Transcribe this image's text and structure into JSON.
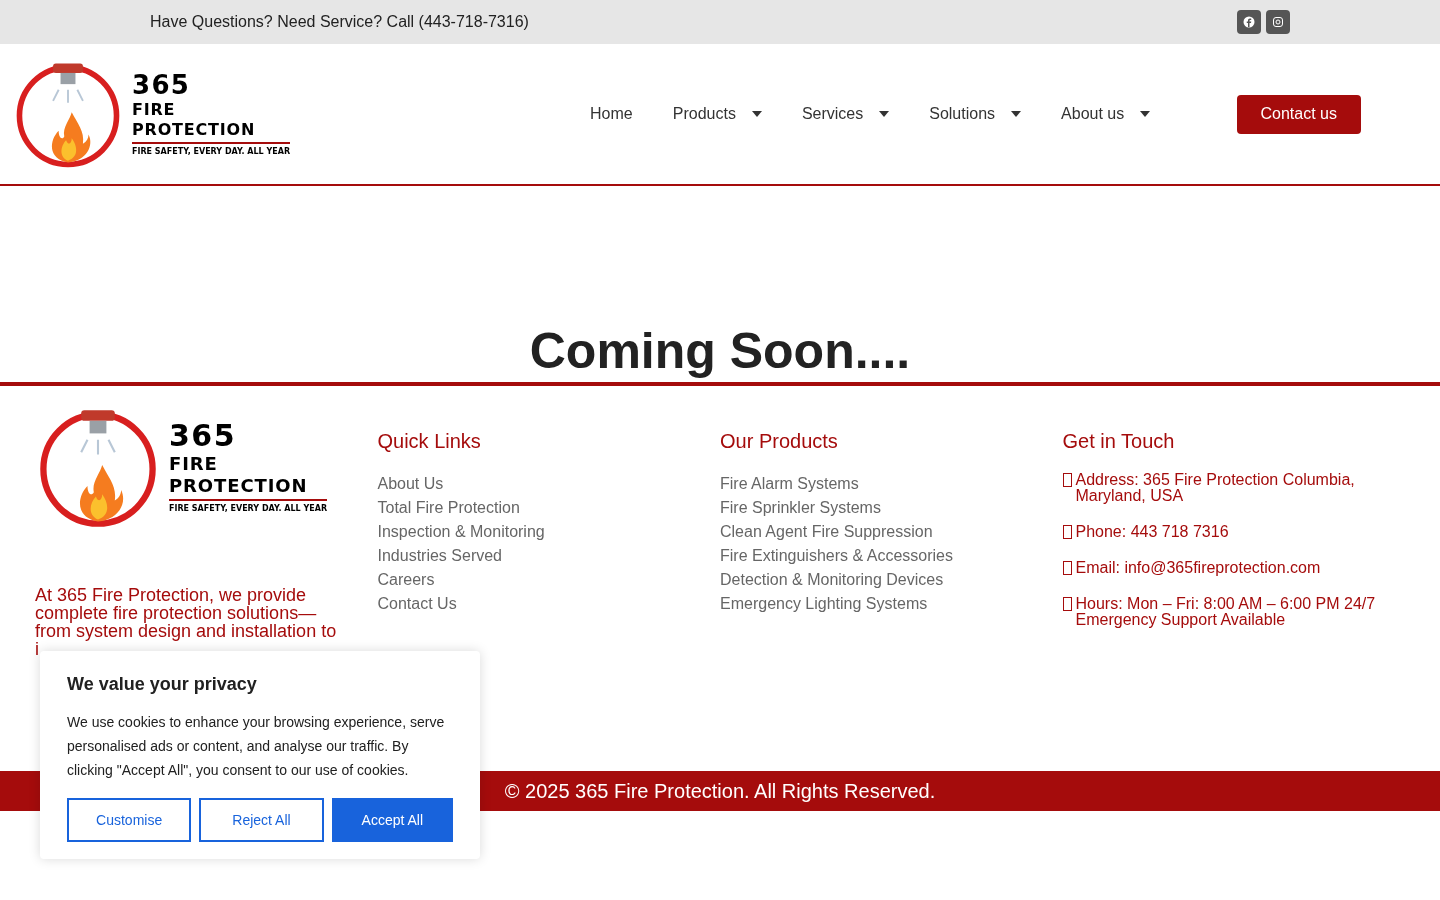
{
  "top_bar": {
    "text": "Have Questions? Need Service? Call (443-718-7316)",
    "social": [
      {
        "kind": "facebook"
      },
      {
        "kind": "instagram"
      }
    ]
  },
  "header_logo": {
    "number": "365",
    "line1": "FIRE",
    "line2": "PROTECTION",
    "tagline": "FIRE SAFETY, EVERY DAY. ALL YEAR"
  },
  "footer_logo": {
    "number": "365",
    "line1": "FIRE",
    "line2": "PROTECTION",
    "tagline": "FIRE SAFETY, EVERY DAY. ALL YEAR"
  },
  "nav": [
    {
      "label": "Home",
      "dropdown": false
    },
    {
      "label": "Products",
      "dropdown": true
    },
    {
      "label": "Services",
      "dropdown": true
    },
    {
      "label": "Solutions",
      "dropdown": true
    },
    {
      "label": "About us",
      "dropdown": true
    }
  ],
  "contact_button": "Contact us",
  "heading": "Coming Soon....",
  "footer": {
    "about_lines": [
      "At 365 Fire Protection, we provide",
      "complete fire protection solutions—",
      "from system design and installation to",
      "i"
    ],
    "quick_links": {
      "title": "Quick Links",
      "items": [
        "About Us",
        "Total Fire Protection",
        "Inspection & Monitoring",
        "Industries Served",
        "Careers",
        "Contact Us"
      ]
    },
    "products": {
      "title": "Our Products",
      "items": [
        "Fire Alarm Systems",
        "Fire Sprinkler Systems",
        "Clean Agent Fire Suppression",
        "Fire Extinguishers & Accessories",
        "Detection & Monitoring Devices",
        "Emergency Lighting Systems"
      ]
    },
    "contact": {
      "title": "Get in Touch",
      "items": [
        "Address: 365 Fire Protection Columbia, Maryland, USA",
        "Phone: 443 718 7316",
        "Email: info@365fireprotection.com",
        "Hours: Mon – Fri: 8:00 AM – 6:00 PM 24/7 Emergency Support Available"
      ]
    }
  },
  "copyright": "© 2025 365 Fire Protection. All Rights Reserved.",
  "cookie": {
    "title": "We value your privacy",
    "text": "We use cookies to enhance your browsing experience, serve personalised ads or content, and analyse our traffic. By clicking \"Accept All\", you consent to our use of cookies.",
    "buttons": [
      {
        "label": "Customise",
        "primary": false
      },
      {
        "label": "Reject All",
        "primary": false
      },
      {
        "label": "Accept All",
        "primary": true
      }
    ]
  }
}
